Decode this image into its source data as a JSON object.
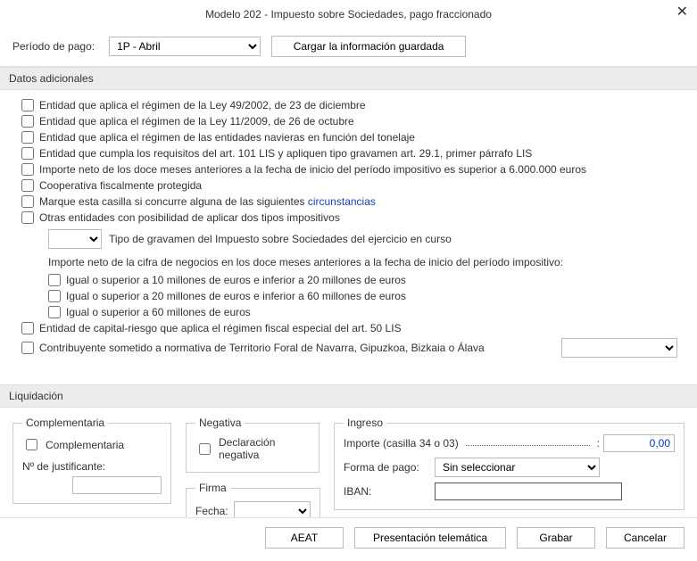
{
  "window": {
    "title": "Modelo 202 - Impuesto sobre Sociedades, pago fraccionado"
  },
  "toolbar": {
    "period_label": "Período de pago:",
    "period_value": "1P - Abril",
    "load_btn": "Cargar la información guardada"
  },
  "sections": {
    "datos_titulo": "Datos adicionales",
    "liq_titulo": "Liquidación"
  },
  "checks": {
    "c1": "Entidad que aplica el régimen de la Ley 49/2002, de 23 de diciembre",
    "c2": "Entidad que aplica el régimen de la Ley 11/2009, de 26 de octubre",
    "c3": "Entidad que aplica el régimen de las entidades navieras en función del tonelaje",
    "c4": "Entidad que cumpla los requisitos del art. 101 LIS y apliquen tipo gravamen art. 29.1, primer párrafo LIS",
    "c5": "Importe neto de los doce meses anteriores a la fecha de inicio del período impositivo es superior a 6.000.000 euros",
    "c6": "Cooperativa fiscalmente protegida",
    "c7a": "Marque esta casilla si concurre alguna de las siguientes ",
    "c7b": "circunstancias",
    "c8": "Otras entidades con posibilidad de aplicar dos tipos impositivos",
    "tipo_label": "Tipo de gravamen del Impuesto sobre Sociedades del ejercicio en curso",
    "neto_note": "Importe neto de la cifra de negocios en los doce meses anteriores a la fecha de inicio del período impositivo:",
    "c9": "Igual o superior a 10 millones de euros e inferior a 20 millones de euros",
    "c10": "Igual o superior a 20 millones de euros e inferior a 60 millones de euros",
    "c11": "Igual o superior a 60 millones de euros",
    "c12": "Entidad de capital-riesgo que aplica el régimen fiscal especial del art. 50 LIS",
    "c13": "Contribuyente sometido a normativa de Territorio Foral de Navarra, Gipuzkoa, Bizkaia o Álava",
    "territorio_value": ""
  },
  "liq": {
    "comp_legend": "Complementaria",
    "comp_label": "Complementaria",
    "just_label": "Nº de justificante:",
    "neg_legend": "Negativa",
    "neg_label": "Declaración negativa",
    "firma_legend": "Firma",
    "fecha_label": "Fecha:",
    "fecha_value": "",
    "ingreso_legend": "Ingreso",
    "importe_label": "Importe (casilla 34 o 03)",
    "importe_value": "0,00",
    "forma_label": "Forma de pago:",
    "forma_value": "Sin seleccionar",
    "iban_label": "IBAN:",
    "iban_value": ""
  },
  "footer": {
    "aeat": "AEAT",
    "presentacion": "Presentación telemática",
    "grabar": "Grabar",
    "cancelar": "Cancelar"
  }
}
